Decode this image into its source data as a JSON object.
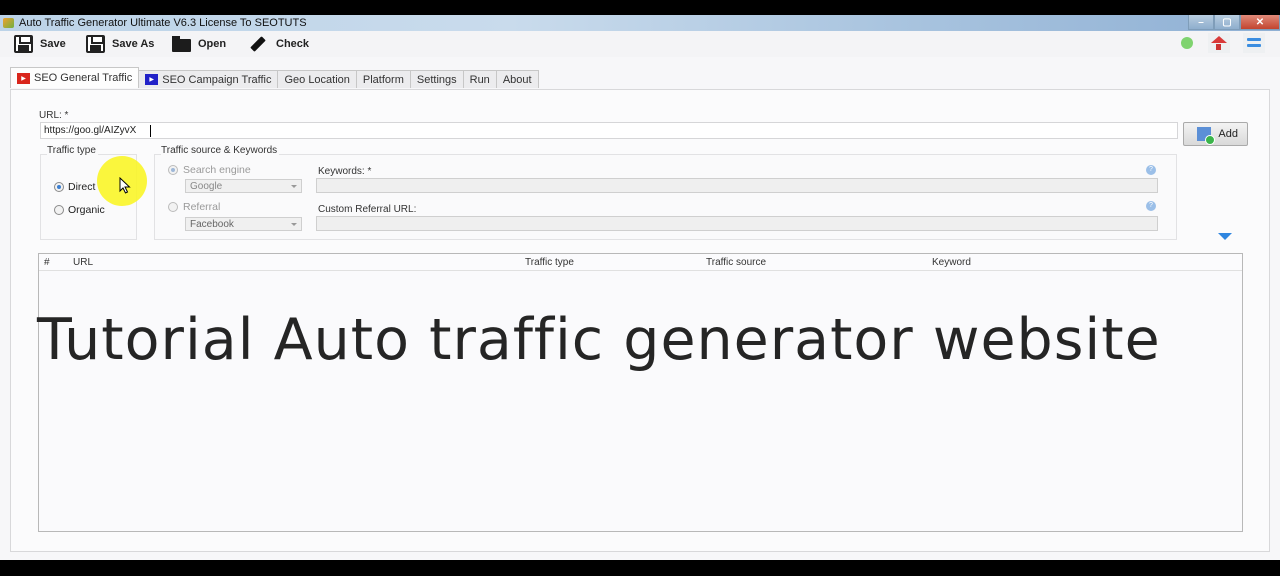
{
  "window": {
    "title": "Auto Traffic Generator Ultimate V6.3 License To SEOTUTS",
    "controls": {
      "minimize": "–",
      "maximize": "▢",
      "close": "✕"
    }
  },
  "toolbar": {
    "save_label": "Save",
    "save_as_label": "Save As",
    "open_label": "Open",
    "check_label": "Check",
    "status_color": "#7fd36f"
  },
  "tabs": [
    {
      "label": "SEO General Traffic",
      "icon": "youtube-red-icon",
      "active": true
    },
    {
      "label": "SEO Campaign Traffic",
      "icon": "play-blue-icon",
      "active": false
    },
    {
      "label": "Geo Location",
      "active": false
    },
    {
      "label": "Platform",
      "active": false
    },
    {
      "label": "Settings",
      "active": false
    },
    {
      "label": "Run",
      "active": false
    },
    {
      "label": "About",
      "active": false
    }
  ],
  "form": {
    "url_label": "URL: *",
    "url_value": "https://goo.gl/AIZyvX",
    "add_label": "Add",
    "traffic_type": {
      "title": "Traffic type",
      "options": [
        {
          "label": "Direct",
          "checked": true
        },
        {
          "label": "Organic",
          "checked": false
        }
      ]
    },
    "traffic_source": {
      "title": "Traffic source & Keywords",
      "search_engine_label": "Search engine",
      "search_engine_selected": "Google",
      "referral_label": "Referral",
      "referral_selected": "Facebook",
      "keywords_label": "Keywords: *",
      "keywords_value": "",
      "custom_referral_label": "Custom Referral URL:",
      "custom_referral_value": ""
    }
  },
  "grid": {
    "columns": [
      "#",
      "URL",
      "Traffic type",
      "Traffic source",
      "Keyword"
    ],
    "rows": []
  },
  "overlay_caption": "Tutorial Auto traffic generator website"
}
